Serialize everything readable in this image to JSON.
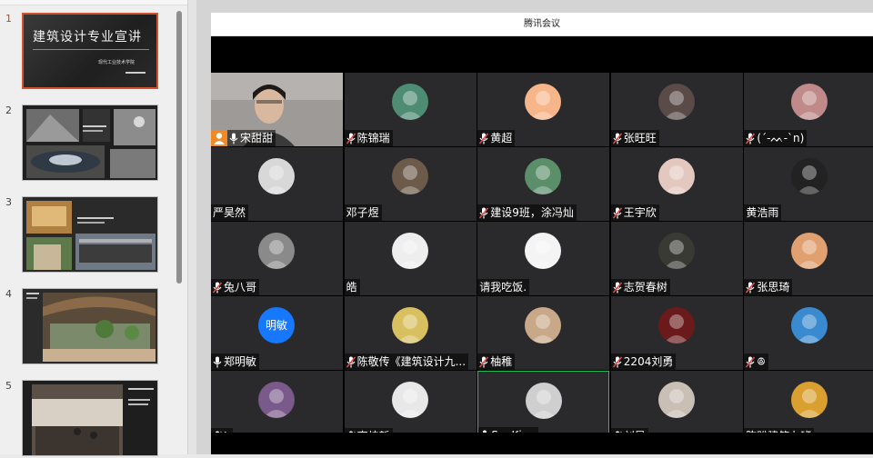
{
  "slides": [
    {
      "number": "1",
      "active": true,
      "title": "建筑设计专业宣讲",
      "subtitle": "现代工业技术学院"
    },
    {
      "number": "2",
      "active": false
    },
    {
      "number": "3",
      "active": false
    },
    {
      "number": "4",
      "active": false
    },
    {
      "number": "5",
      "active": false
    }
  ],
  "meeting": {
    "title": "腾讯会议",
    "colors": {
      "tile": "#2a2a2c",
      "active_speaker": "#1fbf5b",
      "host_badge": "#f08a24",
      "mic_muted": "#e04a4a"
    },
    "participants": [
      {
        "name": "宋甜甜",
        "mic": "on",
        "host": true,
        "video": true
      },
      {
        "name": "陈锦瑞",
        "mic": "muted",
        "avatar_color": "#4e8c74"
      },
      {
        "name": "黄超",
        "mic": "muted",
        "avatar_color": "#f7b58a"
      },
      {
        "name": "张旺旺",
        "mic": "muted",
        "avatar_color": "#5a4a48"
      },
      {
        "name": "(´-ᨓ-`n)",
        "mic": "muted",
        "avatar_color": "#c08a8a"
      },
      {
        "name": "严昊然",
        "mic": "none",
        "avatar_color": "#d8d8d8"
      },
      {
        "name": "邓子煜",
        "mic": "none",
        "avatar_color": "#6c5a4a"
      },
      {
        "name": "建设9班，涂冯灿",
        "mic": "muted",
        "avatar_color": "#5b8f6a"
      },
      {
        "name": "王宇欣",
        "mic": "muted",
        "avatar_color": "#e3c8c0"
      },
      {
        "name": "黄浩雨",
        "mic": "none",
        "avatar_color": "#222222"
      },
      {
        "name": "兔八哥",
        "mic": "muted",
        "avatar_color": "#8a8a8a"
      },
      {
        "name": "皓",
        "mic": "none",
        "avatar_color": "#eeeeee"
      },
      {
        "name": "请我吃饭.",
        "mic": "none",
        "avatar_color": "#f4f4f4"
      },
      {
        "name": "志贺春树",
        "mic": "muted",
        "avatar_color": "#3a3a34"
      },
      {
        "name": "张思琦",
        "mic": "muted",
        "avatar_color": "#e0a070"
      },
      {
        "name": "郑明敏",
        "mic": "on",
        "avatar_color": "#1677ff",
        "avatar_text": "明敏"
      },
      {
        "name": "陈敬传《建筑设计九...",
        "mic": "muted",
        "avatar_color": "#d8c060"
      },
      {
        "name": "柚稚",
        "mic": "muted",
        "avatar_color": "#c8a888"
      },
      {
        "name": "2204刘勇",
        "mic": "muted",
        "avatar_color": "#6a1a1a"
      },
      {
        "name": "ꔮ",
        "mic": "muted",
        "avatar_color": "#3a8ad0"
      },
      {
        "name": "L",
        "mic": "muted",
        "avatar_color": "#7a5a8a"
      },
      {
        "name": "李炜哲",
        "mic": "muted",
        "avatar_color": "#e8e8e8"
      },
      {
        "name": "SeaKing",
        "mic": "on",
        "active": true,
        "avatar_color": "#cfcfcf"
      },
      {
        "name": "刘星",
        "mic": "muted",
        "avatar_color": "#c9bfb5"
      },
      {
        "name": "陈盼建筑九班",
        "mic": "none",
        "avatar_color": "#d9a030"
      }
    ]
  }
}
